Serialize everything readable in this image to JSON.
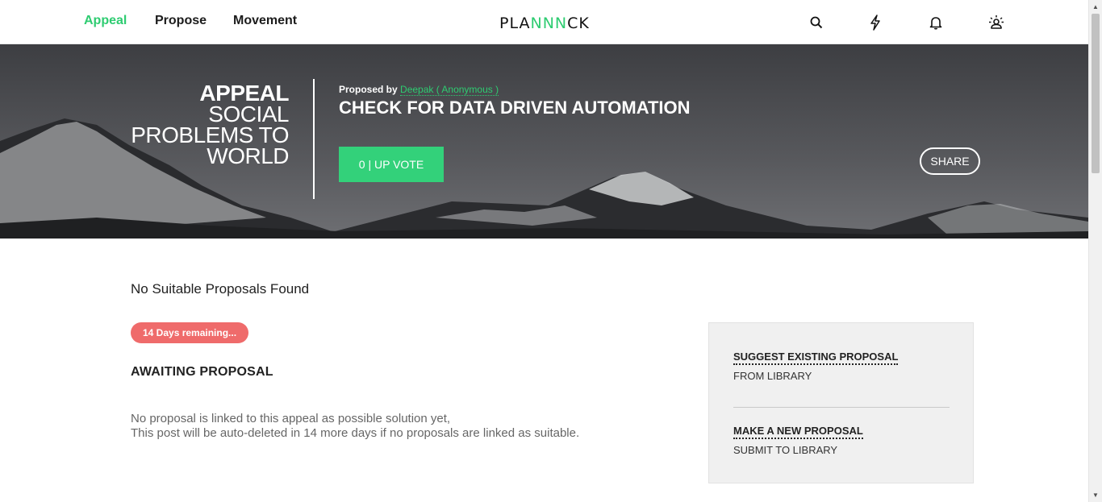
{
  "nav": {
    "links": [
      "Appeal",
      "Propose",
      "Movement"
    ],
    "active": "Appeal",
    "logo": {
      "part1": "PLA",
      "part2": "NNN",
      "part3": "CK"
    },
    "icons": [
      "search-icon",
      "lightning-icon",
      "bell-icon",
      "profile-icon"
    ]
  },
  "hero": {
    "title_line1": "APPEAL",
    "title_line2": "SOCIAL",
    "title_line3": "PROBLEMS TO",
    "title_line4": "WORLD",
    "proposed_by": "Proposed by",
    "author": "Deepak ( Anonymous )",
    "heading": "CHECK FOR DATA DRIVEN AUTOMATION",
    "upvote_label": "0 | UP VOTE",
    "share_label": "SHARE"
  },
  "content": {
    "no_found": "No Suitable Proposals Found",
    "badge": "14 Days remaining...",
    "status": "AWAITING PROPOSAL",
    "desc_line1": "No proposal is linked to this appeal as possible solution yet,",
    "desc_line2": "This post will be auto-deleted in 14 more days if no proposals are linked as suitable."
  },
  "side": {
    "link1": "SUGGEST EXISTING PROPOSAL",
    "sub1": "FROM LIBRARY",
    "link2": "MAKE A NEW PROPOSAL",
    "sub2": "SUBMIT TO LIBRARY"
  },
  "colors": {
    "accent": "#2ecc71",
    "badge": "#ef6b6b",
    "upvote": "#33d17a"
  }
}
